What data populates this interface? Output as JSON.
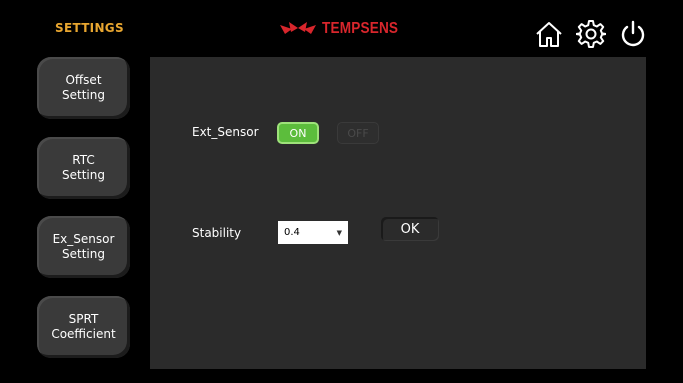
{
  "header": {
    "title": "SETTINGS",
    "brand": "TEMPSENS"
  },
  "icons": [
    "home-icon",
    "gear-icon",
    "power-icon"
  ],
  "sidebar": {
    "items": [
      {
        "label": "Offset\nSetting"
      },
      {
        "label": "RTC\nSetting"
      },
      {
        "label": "Ex_Sensor\nSetting"
      },
      {
        "label": "SPRT\nCoefficient"
      }
    ]
  },
  "main": {
    "ext_sensor_label": "Ext_Sensor",
    "on_label": "ON",
    "off_label": "OFF",
    "stability_label": "Stability",
    "stability_value": "0.4",
    "ok_label": "OK"
  },
  "colors": {
    "title": "#e8a630",
    "brand": "#d8262c",
    "on_active": "#5cbd3c"
  }
}
